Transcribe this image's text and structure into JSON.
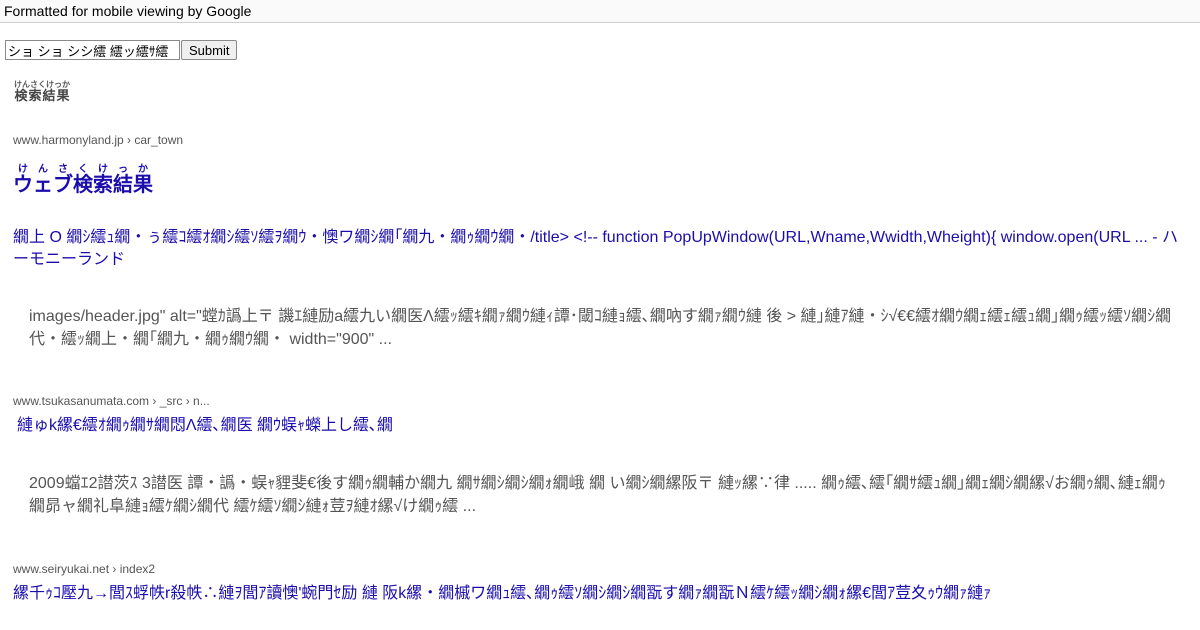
{
  "header": {
    "text": "Formatted for mobile viewing by Google"
  },
  "search": {
    "value": "ショ ショ シシ繧 繧ッ繧ｻ繧",
    "submit_label": "Submit"
  },
  "section_label": {
    "text": "検索結果",
    "ruby": "けんさくけっか"
  },
  "results": [
    {
      "site": "www.harmonyland.jp › car_town",
      "web_title": "ウェブ検索結果",
      "web_title_ruby": "けんさくけっか",
      "link": "繝上 О 繝ｼ繧ｭ繝・ぅ繧ｺ繧ｵ繝ｼ繧ｿ繧ｦ繝ｳ・懊ワ繝ｼ繝｢繝九・繝ｩ繝ｳ繝・/title> <!-- function PopUpWindow(URL,Wname,Wwidth,Wheight){ window.open(URL ... - ハーモニーランド",
      "snippet": "images/header.jpg\" alt=\"螳ｶ譌上〒 譏ｴ縺励a繧九い繝医Λ繧ｯ繧ｷ繝ｧ繝ｳ縺ｨ譚･閾ｺ縺ｮ繧､繝吶す繝ｧ繝ｳ縺 後 > 縺｣縺ｱ縺・ｼ√€€繧ｵ繝ｳ繝ｪ繧ｪ繧ｭ繝｣繝ｩ繧ｯ繧ｿ繝ｼ繝代・繧ｯ繝上・繝｢繝九・繝ｩ繝ｳ繝・ width=\"900\" ..."
    },
    {
      "site": "www.tsukasanumata.com › _src › n...",
      "link": "縺ゅk縲€繧ｵ繝ｩ繝ｻ繝悶Λ繧､繝医 繝ｳ蜈ｬ蠑上し繧､繝",
      "snippet": "2009蟷ｴ2譛茨ｽ 3譛医 譚・譌・蜈ｬ貍斐€後す繝ｩ繝輔か繝九 繝ｻ繝ｼ繝ｼ繝ｫ繝峨 繝 い繝ｼ繝縲阪〒 縺ｯ縲∵律 ..... 繝ｩ繧､繧｢繝ｻ繧ｭ繝｣繝ｪ繝ｼ繝縲√お繝ｩ繝､縺ｪ繝ｩ繝昴ャ繝礼阜縺ｮ繧ｹ繝ｼ繝代 繧ｹ繧ｿ繝ｼ縺ｫ荳ｦ縺ｵ縲√け繝ｩ繧 ..."
    },
    {
      "site": "www.seiryukai.net › index2",
      "link": "縲千ｩｺ壓九→閭ｽ蜉帙r殺帙∴縺ｦ閭ｱ讀懊'蜿門ｾ励 縺 阪k縲・繝槭ワ繝ｭ繧､繝ｩ繧ｿ繝ｼ繝ｼ繝翫す繝ｧ繝翫Ｎ繧ｹ繧ｯ繝ｼ繝ｫ縲€閭ｱ荳夊ｩｳ繝ｧ縺ｧ"
    }
  ]
}
